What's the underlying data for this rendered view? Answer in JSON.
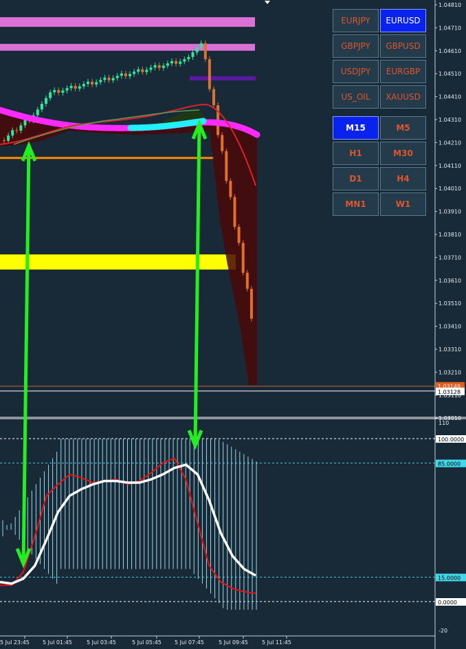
{
  "symbol_buttons": [
    {
      "label": "EURJPY",
      "active": false
    },
    {
      "label": "EURUSD",
      "active": true
    },
    {
      "label": "GBPJPY",
      "active": false
    },
    {
      "label": "GBPUSD",
      "active": false
    },
    {
      "label": "USDJPY",
      "active": false
    },
    {
      "label": "EURGBP",
      "active": false
    },
    {
      "label": "US_OIL",
      "active": false
    },
    {
      "label": "XAUUSD",
      "active": false
    }
  ],
  "timeframe_buttons": [
    {
      "label": "M15",
      "active": true
    },
    {
      "label": "M5",
      "active": false
    },
    {
      "label": "H1",
      "active": false
    },
    {
      "label": "M30",
      "active": false
    },
    {
      "label": "D1",
      "active": false
    },
    {
      "label": "H4",
      "active": false
    },
    {
      "label": "MN1",
      "active": false
    },
    {
      "label": "W1",
      "active": false
    }
  ],
  "price_axis": {
    "ticks": [
      "1.04810",
      "1.04710",
      "1.04610",
      "1.04510",
      "1.04410",
      "1.04310",
      "1.04210",
      "1.04110",
      "1.04010",
      "1.03910",
      "1.03810",
      "1.03710",
      "1.03610",
      "1.03510",
      "1.03410",
      "1.03310",
      "1.03210",
      "1.03110",
      "1.03010"
    ],
    "current_price_label": "1.03149",
    "bid_label": "1.03128"
  },
  "oscillator_axis": {
    "ticks": [
      "110",
      "-20"
    ],
    "level_labels": [
      "100.0000",
      "85.0000",
      "15.0000",
      "0.0000"
    ]
  },
  "time_axis": [
    "5 Jul 23:45",
    "5 Jul 01:45",
    "5 Jul 03:45",
    "5 Jul 05:45",
    "5 Jul 07:45",
    "5 Jul 09:45",
    "5 Jul 11:45"
  ],
  "colors": {
    "background": "#182a38",
    "bull_candle": "#2ee8a0",
    "bear_candle": "#e0702a",
    "ma_magenta": "#ff2aff",
    "ma_cyan": "#22f0ff",
    "ma_red": "#e0202a",
    "arrow": "#22ee22",
    "zone_yellow": "#ffff00",
    "zone_pink": "#da70d6",
    "zone_purple": "#5a1aa0",
    "orange_line": "#ff8c00",
    "osc_white": "#ffffff",
    "osc_red": "#ee1010",
    "osc_histogram": "#9ad8ea"
  },
  "chart_data": [
    {
      "type": "candlestick",
      "ylim": [
        1.0297,
        1.0483
      ],
      "horizontal_levels": [
        {
          "price": 1.04735,
          "color": "pink",
          "kind": "zone"
        },
        {
          "price": 1.04625,
          "color": "pink",
          "kind": "zone"
        },
        {
          "price": 1.0449,
          "color": "purple",
          "kind": "line"
        },
        {
          "price": 1.04143,
          "color": "orange",
          "kind": "line"
        },
        {
          "price": 1.0369,
          "color": "yellow",
          "kind": "zone"
        },
        {
          "price": 1.03149,
          "color": "orange",
          "kind": "price-line"
        },
        {
          "price": 1.03128,
          "color": "white",
          "kind": "bid-line"
        }
      ]
    },
    {
      "type": "line",
      "ylim": [
        -20,
        110
      ],
      "levels": [
        100,
        85,
        15,
        0
      ],
      "series": [
        {
          "values": [
            12,
            11,
            14,
            22,
            38,
            55,
            65,
            69,
            72,
            74,
            74,
            73,
            73,
            75,
            78,
            82,
            84,
            78,
            62,
            42,
            28,
            20,
            16
          ]
        },
        {
          "values": [
            10,
            10,
            18,
            40,
            65,
            72,
            78,
            76,
            73,
            74,
            75,
            72,
            74,
            79,
            85,
            88,
            75,
            48,
            22,
            12,
            8,
            6,
            5
          ]
        }
      ]
    }
  ]
}
